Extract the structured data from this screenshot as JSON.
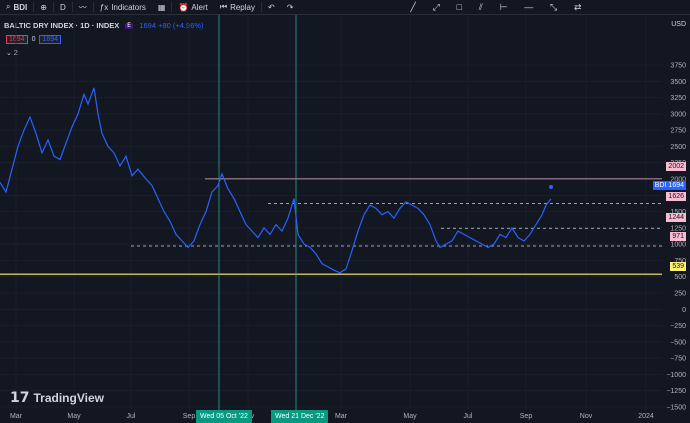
{
  "toolbar": {
    "symbol": "BDI",
    "interval": "D",
    "indicators_label": "Indicators",
    "alert_label": "Alert",
    "replay_label": "Replay"
  },
  "legend": {
    "title": "BALTIC DRY INDEX · 1D · INDEX",
    "badge": "E",
    "values": "1694 +80 (+4.96%)",
    "price_sell": "1694",
    "spread": "0",
    "price_buy": "1694",
    "collapsed_count": "2"
  },
  "currency": "USD",
  "price_axis": [
    "3750",
    "3500",
    "3250",
    "3000",
    "2750",
    "2500",
    "2250",
    "2000",
    "1750",
    "1500",
    "1250",
    "1000",
    "750",
    "500",
    "250",
    "0",
    "−250",
    "−500",
    "−750",
    "−1000",
    "−1250",
    "−1500"
  ],
  "time_axis": [
    "Mar",
    "May",
    "Jul",
    "Sep",
    "Nov",
    "Mar",
    "May",
    "Jul",
    "Sep",
    "Nov",
    "2024"
  ],
  "crosshair_dates": [
    "Wed 05 Oct '22",
    "Wed 21 Dec '22"
  ],
  "price_levels": [
    {
      "label": "2002",
      "color": "#f8bbd0"
    },
    {
      "label": "1626",
      "color": "#f8bbd0"
    },
    {
      "label": "1244",
      "color": "#f8bbd0"
    },
    {
      "label": "971",
      "color": "#f8bbd0"
    },
    {
      "label": "539",
      "color": "#fff176"
    }
  ],
  "last_price": {
    "symbol": "BDI",
    "value": "1694",
    "color": "#2962ff"
  },
  "chart_data": {
    "type": "line",
    "series": [
      {
        "name": "BDI",
        "color": "#2962ff"
      }
    ],
    "ylim": [
      -1500,
      3750
    ],
    "grid": true
  },
  "branding": "TradingView"
}
